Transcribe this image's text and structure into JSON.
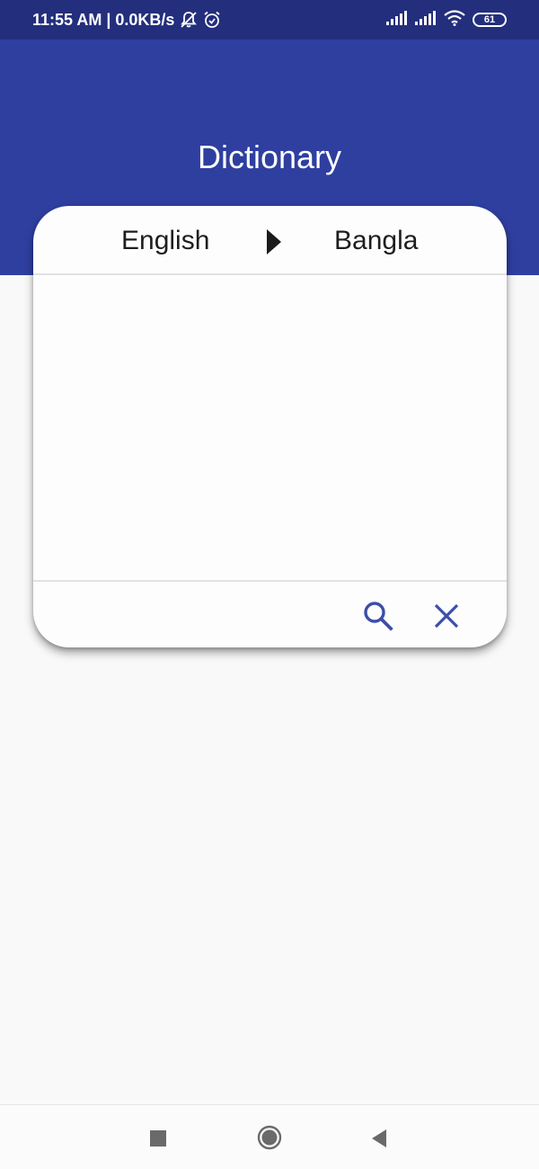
{
  "status_bar": {
    "time_speed": "11:55 AM | 0.0KB/s",
    "battery": "61",
    "icons": [
      "notifications-off-icon",
      "alarm-icon",
      "signal-icon",
      "signal-icon",
      "wifi-icon",
      "battery-icon"
    ]
  },
  "app_bar": {
    "title": "Dictionary",
    "color": "#2e3f9f"
  },
  "translator": {
    "source_language": "English",
    "target_language": "Bangla",
    "swap_icon": "triangle-right-icon",
    "search_input": {
      "value": "",
      "placeholder": ""
    },
    "search_icon": "search-icon",
    "clear_icon": "close-icon",
    "accent_color": "#3d4ea8"
  },
  "nav_bar": {
    "icons": [
      "recents-square-icon",
      "home-circle-icon",
      "back-triangle-icon"
    ]
  }
}
